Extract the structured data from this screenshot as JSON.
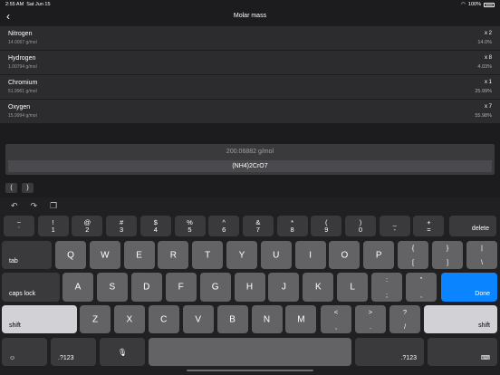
{
  "status": {
    "time": "2:55 AM",
    "date": "Sat Jun 15",
    "battery": "100%"
  },
  "nav": {
    "back_icon": "chevron-left-icon",
    "title": "Molar mass"
  },
  "elements": [
    {
      "name": "Nitrogen",
      "mass": "14.0067 g/mol",
      "count": "x 2",
      "percent": "14.0%"
    },
    {
      "name": "Hydrogen",
      "mass": "1.00794 g/mol",
      "count": "x 8",
      "percent": "4.03%"
    },
    {
      "name": "Chromium",
      "mass": "51.9961 g/mol",
      "count": "x 1",
      "percent": "25.99%"
    },
    {
      "name": "Oxygen",
      "mass": "15.9994 g/mol",
      "count": "x 7",
      "percent": "55.98%"
    }
  ],
  "result": {
    "value": "200.06882 g/mol",
    "formula": "(NH4)2CrO7"
  },
  "paren": {
    "open": "(",
    "close": ")"
  },
  "keyboard": {
    "number_row": [
      {
        "top": "~",
        "bot": "`"
      },
      {
        "top": "!",
        "bot": "1"
      },
      {
        "top": "@",
        "bot": "2"
      },
      {
        "top": "#",
        "bot": "3"
      },
      {
        "top": "$",
        "bot": "4"
      },
      {
        "top": "%",
        "bot": "5"
      },
      {
        "top": "^",
        "bot": "6"
      },
      {
        "top": "&",
        "bot": "7"
      },
      {
        "top": "*",
        "bot": "8"
      },
      {
        "top": "(",
        "bot": "9"
      },
      {
        "top": ")",
        "bot": "0"
      },
      {
        "top": "_",
        "bot": "-"
      },
      {
        "top": "+",
        "bot": "="
      }
    ],
    "delete": "delete",
    "tab": "tab",
    "row_q": [
      "Q",
      "W",
      "E",
      "R",
      "T",
      "Y",
      "U",
      "I",
      "O",
      "P"
    ],
    "brackets": [
      {
        "top": "{",
        "bot": "["
      },
      {
        "top": "}",
        "bot": "]"
      },
      {
        "top": "|",
        "bot": "\\"
      }
    ],
    "caps": "caps lock",
    "row_a": [
      "A",
      "S",
      "D",
      "F",
      "G",
      "H",
      "J",
      "K",
      "L"
    ],
    "semi": {
      "top": ":",
      "bot": ";"
    },
    "quote": {
      "top": "\"",
      "bot": ","
    },
    "done": "Done",
    "shift": "shift",
    "row_z": [
      "Z",
      "X",
      "C",
      "V",
      "B",
      "N",
      "M"
    ],
    "punct": [
      {
        "top": "<",
        "bot": ","
      },
      {
        "top": ">",
        "bot": "."
      },
      {
        "top": "?",
        "bot": "/"
      }
    ],
    "num_switch": ".?123"
  }
}
